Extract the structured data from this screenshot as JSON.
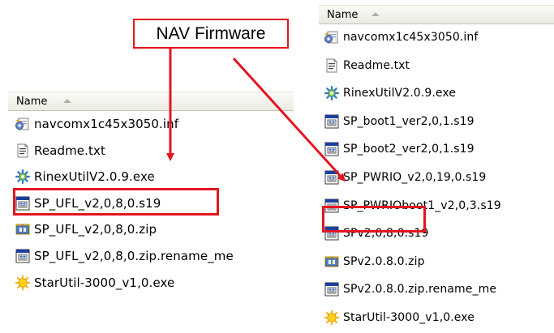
{
  "callout": {
    "text": "NAV Firmware"
  },
  "left_pane": {
    "header": "Name",
    "files": [
      {
        "name": "navcomx1c45x3050.inf",
        "icon": "inf-settings-icon"
      },
      {
        "name": "Readme.txt",
        "icon": "text-file-icon"
      },
      {
        "name": "RinexUtilV2.0.9.exe",
        "icon": "gear-exe-icon"
      },
      {
        "name": "SP_UFL_v2,0,8,0.s19",
        "icon": "firmware-file-icon"
      },
      {
        "name": "SP_UFL_v2,0,8,0.zip",
        "icon": "zip-folder-icon"
      },
      {
        "name": "SP_UFL_v2,0,8,0.zip.rename_me",
        "icon": "firmware-file-icon"
      },
      {
        "name": "StarUtil-3000_v1,0.exe",
        "icon": "sun-exe-icon"
      }
    ]
  },
  "right_pane": {
    "header": "Name",
    "files": [
      {
        "name": "navcomx1c45x3050.inf",
        "icon": "inf-settings-icon"
      },
      {
        "name": "Readme.txt",
        "icon": "text-file-icon"
      },
      {
        "name": "RinexUtilV2.0.9.exe",
        "icon": "gear-exe-icon"
      },
      {
        "name": "SP_boot1_ver2,0,1.s19",
        "icon": "firmware-file-icon"
      },
      {
        "name": "SP_boot2_ver2,0,1.s19",
        "icon": "firmware-file-icon"
      },
      {
        "name": "SP_PWRIO_v2,0,19,0.s19",
        "icon": "firmware-file-icon"
      },
      {
        "name": "SP_PWRIOboot1_v2,0,3.s19",
        "icon": "firmware-file-icon"
      },
      {
        "name": "SPv2,0,8,0.s19",
        "icon": "firmware-file-icon"
      },
      {
        "name": "SPv2.0.8.0.zip",
        "icon": "zip-folder-icon"
      },
      {
        "name": "SPv2.0.8.0.zip.rename_me",
        "icon": "firmware-file-icon"
      },
      {
        "name": "StarUtil-3000_v1,0.exe",
        "icon": "sun-exe-icon"
      }
    ]
  },
  "colors": {
    "highlight": "#e3151f",
    "header_bg": "#ebeae4"
  }
}
